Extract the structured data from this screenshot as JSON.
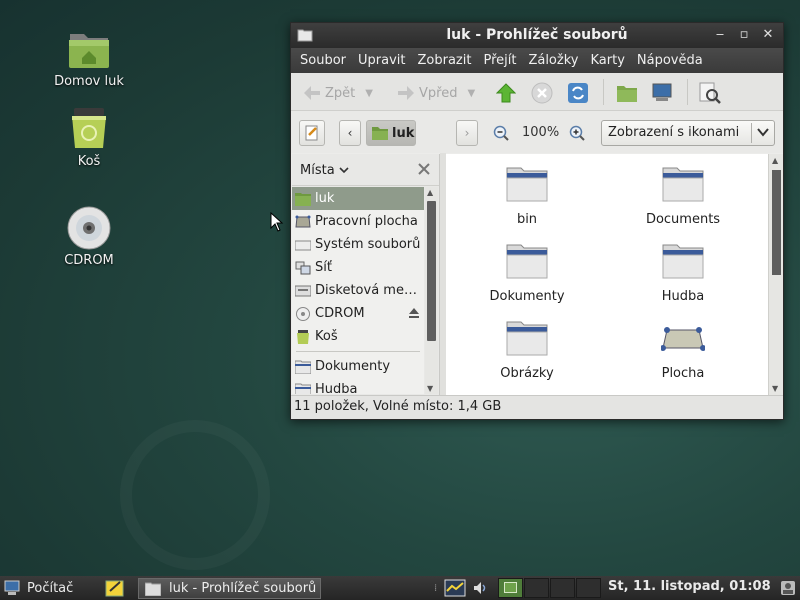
{
  "desktop": {
    "icons": [
      {
        "label": "Domov luk",
        "icon": "home-folder-icon"
      },
      {
        "label": "Koš",
        "icon": "trash-icon"
      },
      {
        "label": "CDROM",
        "icon": "cdrom-icon"
      }
    ]
  },
  "window": {
    "title": "luk -  Prohlížeč souborů",
    "menu": [
      "Soubor",
      "Upravit",
      "Zobrazit",
      "Přejít",
      "Záložky",
      "Karty",
      "Nápověda"
    ],
    "toolbar": {
      "back_label": "Zpět",
      "forward_label": "Vpřed"
    },
    "location": {
      "current": "luk",
      "zoom": "100%",
      "view_mode": "Zobrazení s ikonami"
    },
    "sidebar": {
      "title": "Místa",
      "places": [
        {
          "label": "luk",
          "icon": "home-folder-icon"
        },
        {
          "label": "Pracovní plocha",
          "icon": "desktop-icon"
        },
        {
          "label": "Systém souborů",
          "icon": "drive-icon"
        },
        {
          "label": "Síť",
          "icon": "network-icon"
        },
        {
          "label": "Disketová me…",
          "icon": "floppy-icon"
        },
        {
          "label": "CDROM",
          "icon": "cdrom-icon"
        },
        {
          "label": "Koš",
          "icon": "trash-icon"
        }
      ],
      "bookmarks": [
        {
          "label": "Dokumenty",
          "icon": "folder-icon"
        },
        {
          "label": "Hudba",
          "icon": "folder-icon"
        }
      ]
    },
    "files": [
      {
        "name": "bin",
        "icon": "folder-icon"
      },
      {
        "name": "Documents",
        "icon": "folder-icon"
      },
      {
        "name": "Dokumenty",
        "icon": "folder-icon"
      },
      {
        "name": "Hudba",
        "icon": "folder-icon"
      },
      {
        "name": "Obrázky",
        "icon": "folder-icon"
      },
      {
        "name": "Plocha",
        "icon": "desktop-icon"
      }
    ],
    "status": "11 položek, Volné místo: 1,4 GB"
  },
  "panel": {
    "menu_label": "Počítač",
    "task_label": "luk - Prohlížeč souborů",
    "clock": "St, 11. listopad, 01:08"
  }
}
